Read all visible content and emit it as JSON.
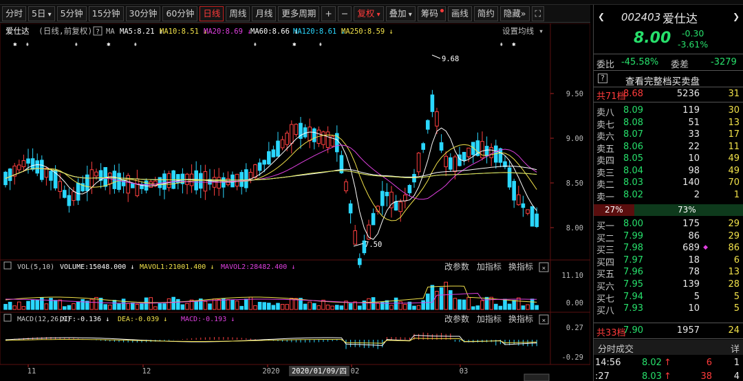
{
  "toolbar": {
    "items": [
      {
        "label": "分时",
        "state": ""
      },
      {
        "label": "5日",
        "state": "dropdown"
      },
      {
        "label": "5分钟",
        "state": ""
      },
      {
        "label": "15分钟",
        "state": ""
      },
      {
        "label": "30分钟",
        "state": ""
      },
      {
        "label": "60分钟",
        "state": ""
      },
      {
        "label": "日线",
        "state": "active"
      },
      {
        "label": "周线",
        "state": ""
      },
      {
        "label": "月线",
        "state": ""
      },
      {
        "label": "更多周期",
        "state": ""
      },
      {
        "label": "+",
        "state": ""
      },
      {
        "label": "−",
        "state": ""
      },
      {
        "label": "复权",
        "state": "red-dropdown"
      },
      {
        "label": "叠加",
        "state": "dropdown"
      },
      {
        "label": "筹码",
        "state": "dot"
      },
      {
        "label": "画线",
        "state": ""
      },
      {
        "label": "简约",
        "state": ""
      },
      {
        "label": "隐藏",
        "state": "chevrons"
      }
    ],
    "expand_icon": "expand-icon"
  },
  "main_header": {
    "name": "爱仕达",
    "mode": "(日线,前复权)",
    "help": "?",
    "ma_label": "MA",
    "ma": [
      {
        "text": "MA5:8.21",
        "color": "#ffffff"
      },
      {
        "text": "MA10:8.51",
        "color": "#f2e24a"
      },
      {
        "text": "MA20:8.69",
        "color": "#e040e0"
      },
      {
        "text": "MA60:8.66",
        "color": "#ffffff"
      },
      {
        "text": "MA120:8.61",
        "color": "#2ad7ff"
      },
      {
        "text": "MA250:8.59",
        "color": "#f2e24a"
      }
    ],
    "settings": "设置均线"
  },
  "price_axis": [
    "9.50",
    "9.00",
    "8.50",
    "8.00"
  ],
  "annotations": {
    "high": "9.68",
    "low": "7.50"
  },
  "vol_header": {
    "title": "VOL(5,10)",
    "items": [
      {
        "text": "VOLUME:15048.000",
        "color": "#ffffff"
      },
      {
        "text": "MAVOL1:21001.400",
        "color": "#f2e24a"
      },
      {
        "text": "MAVOL2:28482.400",
        "color": "#e040e0"
      }
    ],
    "buttons": [
      "改参数",
      "加指标",
      "换指标"
    ],
    "axis": [
      "11.10",
      "0.00"
    ]
  },
  "macd_header": {
    "title": "MACD(12,26,9)",
    "items": [
      {
        "text": "DIF:-0.136",
        "color": "#ffffff"
      },
      {
        "text": "DEA:-0.039",
        "color": "#f2e24a"
      },
      {
        "text": "MACD:-0.193",
        "color": "#e040e0"
      }
    ],
    "buttons": [
      "改参数",
      "加指标",
      "换指标"
    ],
    "axis": [
      "0.27",
      "-0.29"
    ]
  },
  "date_axis": {
    "labels": [
      "11",
      "12",
      "2020",
      "02",
      "03"
    ],
    "cursor": "2020/01/09/四"
  },
  "quote": {
    "code": "002403",
    "name": "爱仕达",
    "price": "8.00",
    "change": "-0.30",
    "pct": "-3.61%",
    "weibi_label": "委比",
    "weibi": "-45.58%",
    "weicha_label": "委差",
    "weicha": "-3279",
    "full_book": "查看完整档买卖盘",
    "sell_total": {
      "label": "共71档",
      "price": "8.68",
      "vol": "5236",
      "count": "31"
    },
    "asks": [
      {
        "label": "卖八",
        "price": "8.09",
        "vol": "119",
        "count": "30"
      },
      {
        "label": "卖七",
        "price": "8.08",
        "vol": "51",
        "count": "13"
      },
      {
        "label": "卖六",
        "price": "8.07",
        "vol": "33",
        "count": "17"
      },
      {
        "label": "卖五",
        "price": "8.06",
        "vol": "22",
        "count": "11"
      },
      {
        "label": "卖四",
        "price": "8.05",
        "vol": "10",
        "count": "49"
      },
      {
        "label": "卖三",
        "price": "8.04",
        "vol": "98",
        "count": "49"
      },
      {
        "label": "卖二",
        "price": "8.03",
        "vol": "140",
        "count": "70"
      },
      {
        "label": "卖一",
        "price": "8.02",
        "vol": "2",
        "count": "1"
      }
    ],
    "ratio": {
      "sell": "27%",
      "buy": "73%",
      "sell_fraction": 0.27
    },
    "bids": [
      {
        "label": "买一",
        "price": "8.00",
        "vol": "175",
        "count": "29"
      },
      {
        "label": "买二",
        "price": "7.99",
        "vol": "86",
        "count": "29"
      },
      {
        "label": "买三",
        "price": "7.98",
        "vol": "689",
        "count": "86"
      },
      {
        "label": "买四",
        "price": "7.97",
        "vol": "18",
        "count": "6"
      },
      {
        "label": "买五",
        "price": "7.96",
        "vol": "78",
        "count": "13"
      },
      {
        "label": "买六",
        "price": "7.95",
        "vol": "139",
        "count": "28"
      },
      {
        "label": "买七",
        "price": "7.94",
        "vol": "5",
        "count": "5"
      },
      {
        "label": "买八",
        "price": "7.93",
        "vol": "10",
        "count": "5"
      }
    ],
    "buy_total": {
      "label": "共33档",
      "price": "7.90",
      "vol": "1957",
      "count": "24"
    },
    "trades_title": "分时成交",
    "trades_detail": "详",
    "trades": [
      {
        "time": "14:56",
        "price": "8.02",
        "vol": "6",
        "count": "1"
      },
      {
        "time": ":27",
        "price": "8.03",
        "vol": "38",
        "count": "4"
      }
    ]
  }
}
